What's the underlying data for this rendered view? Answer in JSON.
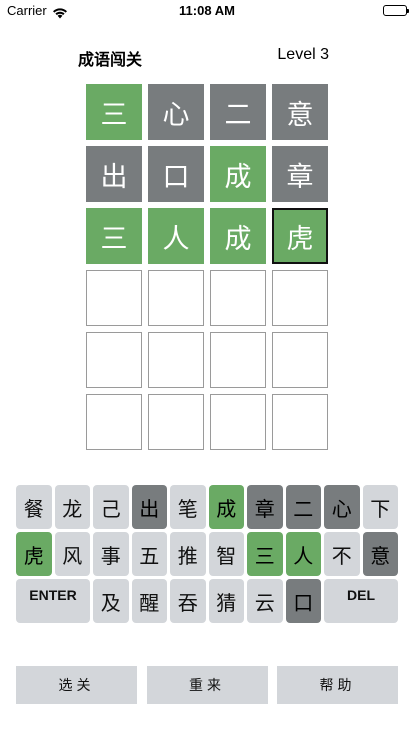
{
  "status_bar": {
    "carrier": "Carrier",
    "time": "11:08 AM"
  },
  "header": {
    "title": "成语闯关",
    "level": "Level 3"
  },
  "colors": {
    "correct": "#6aaa64",
    "absent": "#787c7e",
    "key_default": "#d3d6da",
    "empty_border": "#9a9a9a"
  },
  "grid": {
    "rows": [
      [
        {
          "char": "三",
          "state": "correct"
        },
        {
          "char": "心",
          "state": "absent"
        },
        {
          "char": "二",
          "state": "absent"
        },
        {
          "char": "意",
          "state": "absent"
        }
      ],
      [
        {
          "char": "出",
          "state": "absent"
        },
        {
          "char": "口",
          "state": "absent"
        },
        {
          "char": "成",
          "state": "correct"
        },
        {
          "char": "章",
          "state": "absent"
        }
      ],
      [
        {
          "char": "三",
          "state": "correct"
        },
        {
          "char": "人",
          "state": "correct"
        },
        {
          "char": "成",
          "state": "correct"
        },
        {
          "char": "虎",
          "state": "correct",
          "active": true
        }
      ],
      [
        {
          "char": "",
          "state": "empty"
        },
        {
          "char": "",
          "state": "empty"
        },
        {
          "char": "",
          "state": "empty"
        },
        {
          "char": "",
          "state": "empty"
        }
      ],
      [
        {
          "char": "",
          "state": "empty"
        },
        {
          "char": "",
          "state": "empty"
        },
        {
          "char": "",
          "state": "empty"
        },
        {
          "char": "",
          "state": "empty"
        }
      ],
      [
        {
          "char": "",
          "state": "empty"
        },
        {
          "char": "",
          "state": "empty"
        },
        {
          "char": "",
          "state": "empty"
        },
        {
          "char": "",
          "state": "empty"
        }
      ]
    ]
  },
  "keyboard": {
    "rows": [
      [
        {
          "label": "餐",
          "state": "default"
        },
        {
          "label": "龙",
          "state": "default"
        },
        {
          "label": "己",
          "state": "default"
        },
        {
          "label": "出",
          "state": "absent"
        },
        {
          "label": "笔",
          "state": "default"
        },
        {
          "label": "成",
          "state": "correct"
        },
        {
          "label": "章",
          "state": "absent"
        },
        {
          "label": "二",
          "state": "absent"
        },
        {
          "label": "心",
          "state": "absent"
        },
        {
          "label": "下",
          "state": "default"
        }
      ],
      [
        {
          "label": "虎",
          "state": "correct"
        },
        {
          "label": "风",
          "state": "default"
        },
        {
          "label": "事",
          "state": "default"
        },
        {
          "label": "五",
          "state": "default"
        },
        {
          "label": "推",
          "state": "default"
        },
        {
          "label": "智",
          "state": "default"
        },
        {
          "label": "三",
          "state": "correct"
        },
        {
          "label": "人",
          "state": "correct"
        },
        {
          "label": "不",
          "state": "default"
        },
        {
          "label": "意",
          "state": "absent"
        }
      ],
      [
        {
          "label": "ENTER",
          "state": "default",
          "wide": true
        },
        {
          "label": "及",
          "state": "default"
        },
        {
          "label": "醒",
          "state": "default"
        },
        {
          "label": "吞",
          "state": "default"
        },
        {
          "label": "猜",
          "state": "default"
        },
        {
          "label": "云",
          "state": "default"
        },
        {
          "label": "口",
          "state": "absent"
        },
        {
          "label": "DEL",
          "state": "default",
          "wide": true
        }
      ]
    ]
  },
  "buttons": {
    "select_level": "选关",
    "restart": "重来",
    "help": "帮助"
  }
}
